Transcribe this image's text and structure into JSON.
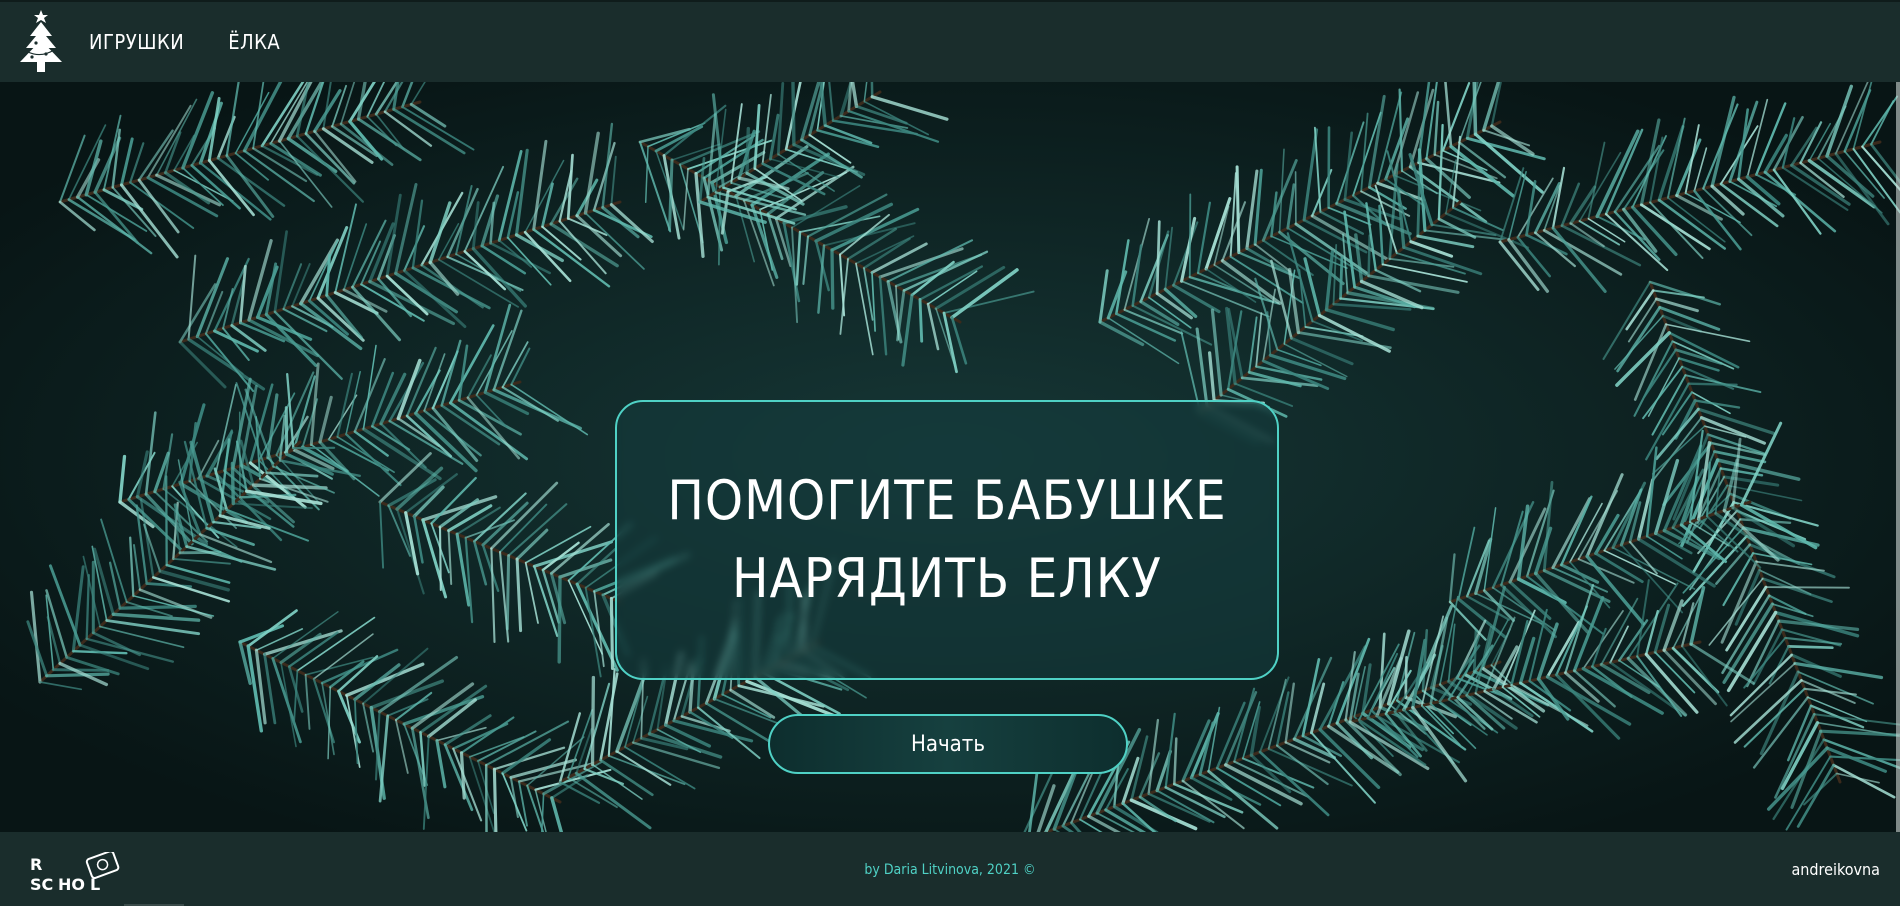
{
  "header": {
    "logo_icon": "christmas-tree-icon",
    "nav": [
      {
        "label": "ИГРУШКИ"
      },
      {
        "label": "ЁЛКА"
      }
    ]
  },
  "hero": {
    "background": "fir-branches-photo",
    "title_line1": "ПОМОГИТЕ БАБУШКЕ",
    "title_line2": "НАРЯДИТЬ ЕЛКУ",
    "start_label": "Начать"
  },
  "footer": {
    "school_logo": "rs-school-logo",
    "copyright": "by Daria Litvinova, 2021 ©",
    "github": "andreikovna"
  },
  "colors": {
    "bar_bg": "#1a2d2c",
    "accent": "#4fd1c5",
    "text": "#ffffff"
  }
}
